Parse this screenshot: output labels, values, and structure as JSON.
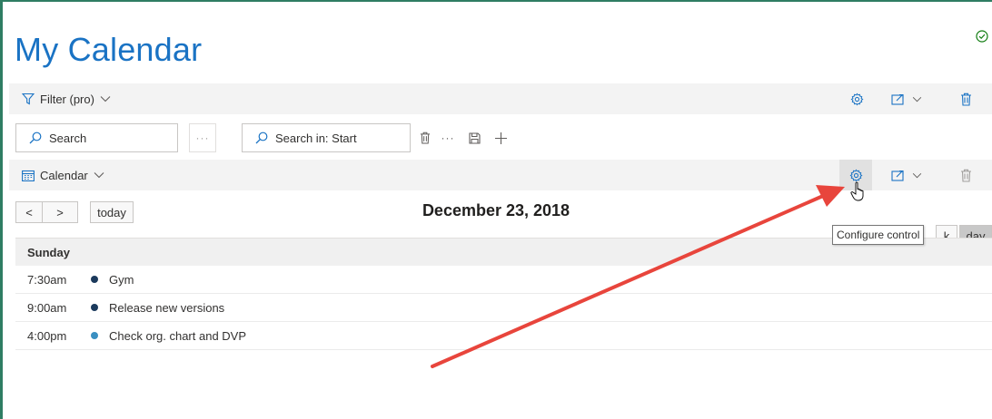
{
  "page": {
    "title": "My Calendar"
  },
  "filter_bar": {
    "label": "Filter (pro)"
  },
  "search": {
    "main_label": "Search",
    "scoped_label": "Search in: Start",
    "more_label": "···"
  },
  "calendar_bar": {
    "label": "Calendar"
  },
  "nav": {
    "prev": "<",
    "next": ">",
    "today": "today"
  },
  "date_title": "December 23, 2018",
  "tooltip": "Configure control",
  "view": {
    "partial": "k",
    "day": "day"
  },
  "day": {
    "name": "Sunday",
    "events": [
      {
        "time": "7:30am",
        "title": "Gym",
        "color": "#1b3a5c"
      },
      {
        "time": "9:00am",
        "title": "Release new versions",
        "color": "#1b3a5c"
      },
      {
        "time": "4:00pm",
        "title": "Check org. chart and DVP",
        "color": "#3a8fc1"
      }
    ]
  },
  "colors": {
    "accent": "#1a73c4",
    "annotation_arrow": "#e8453c",
    "status_ok": "#107c10"
  }
}
